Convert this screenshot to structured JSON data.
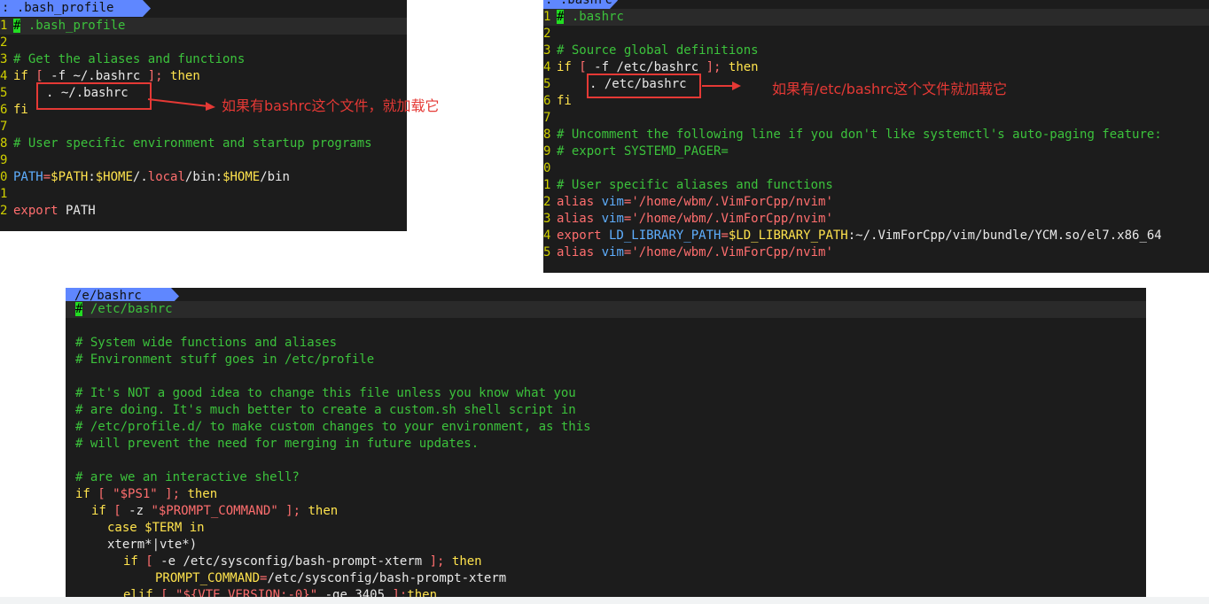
{
  "colors": {
    "terminal_bg": "#1c1c1c",
    "tab_bg": "#5f87ff",
    "comment": "#3cc23c",
    "keyword": "#ffe34d",
    "string": "#ff6e6e",
    "variable": "#5fafff",
    "line_number": "#d0d000",
    "annotation": "#e53935"
  },
  "panels": {
    "bash_profile": {
      "tab_label": ": .bash_profile",
      "line_numbers": [
        "1",
        "2",
        "3",
        "4",
        "5",
        "6",
        "7",
        "8",
        "9",
        "0",
        "1",
        "2"
      ],
      "annotation_text": "如果有bashrc这个文件，就加载它"
    },
    "bashrc": {
      "tab_label": ". .bashrc",
      "line_numbers": [
        "1",
        "2",
        "3",
        "4",
        "5",
        "6",
        "7",
        "8",
        "9",
        "0",
        "1",
        "2",
        "3",
        "4",
        "5"
      ],
      "annotation_text": "如果有/etc/bashrc这个文件就加载它"
    },
    "etc_bashrc": {
      "tab_label": "/e/bashrc",
      "comments": {
        "title": " /etc/bashrc",
        "c1": "# System wide functions and aliases",
        "c2": "# Environment stuff goes in /etc/profile",
        "c3": "# It's NOT a good idea to change this file unless you know what you",
        "c4": "# are doing. It's much better to create a custom.sh shell script in",
        "c5": "# /etc/profile.d/ to make custom changes to your environment, as this",
        "c6": "# will prevent the need for merging in future updates.",
        "c7": "# are we an interactive shell?"
      }
    }
  },
  "code": {
    "hash": "#",
    "bp_title": " .bash_profile",
    "bp_c1": "# Get the aliases and functions",
    "bp_if": "if",
    "bp_br1": " [ ",
    "bp_test": "-f ~/.bashrc",
    "bp_br2": " ]; ",
    "then": "then",
    "bp_source": ". ~/.bashrc",
    "fi": "fi",
    "bp_c2": "# User specific environment and startup programs",
    "bp_path": "PATH",
    "eq": "=",
    "bp_path_v1": "$PATH",
    "bp_path_t1": ":",
    "bp_path_v2": "$HOME",
    "bp_path_t2": "/.",
    "bp_local": "local",
    "bp_path_t3": "/bin:",
    "bp_path_v3": "$HOME",
    "bp_path_t4": "/bin",
    "export": "export",
    "bp_export_rest": " PATH",
    "rc_title": " .bashrc",
    "rc_c1": "# Source global definitions",
    "rc_br1": " [ ",
    "rc_test": "-f /etc/bashrc",
    "rc_br2": " ]; ",
    "rc_source": ". /etc/bashrc",
    "rc_c2": "# Uncomment the following line if you don't like systemctl's auto-paging feature:",
    "rc_c3": "# export SYSTEMD_PAGER=",
    "rc_c4": "# User specific aliases and functions",
    "alias": "alias",
    "rc_alias_name": " vim",
    "rc_alias_val": "'/home/wbm/.VimForCpp/nvim'",
    "rc_ld": " LD_LIBRARY_PATH",
    "rc_ld_var": "$LD_LIBRARY_PATH",
    "rc_ld_rest": ":~/.VimForCpp/vim/bundle/YCM.so/el7.x86_64",
    "eb_if": "if",
    "eb_br1": " [ ",
    "eb_ps1": "\"$PS1\"",
    "eb_br2": " ]; ",
    "eb_test2": "-z ",
    "eb_prompt": "\"$PROMPT_COMMAND\"",
    "case": "case",
    "eb_term": " $TERM ",
    "in": "in",
    "eb_xterm": "xterm*|vte*)",
    "eb_test3": "-e ",
    "eb_bpx": "/etc/sysconfig/bash-prompt-xterm",
    "eb_pc": "PROMPT_COMMAND",
    "eb_pcval": "/etc/sysconfig/bash-prompt-xterm",
    "elif": "elif",
    "eb_vte": "\"${VTE_VERSION:-0}\"",
    "eb_ge": " -ge 3405 ",
    "eb_br3": "];"
  }
}
